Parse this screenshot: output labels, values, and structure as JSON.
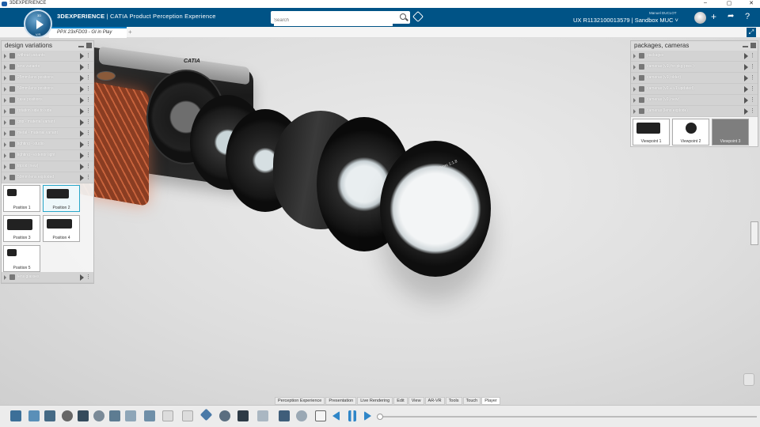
{
  "os_bar": {
    "title": "3DEXPERIENCE"
  },
  "header": {
    "brand_bold": "3DEXPERIENCE",
    "brand_rest": " | CATIA Product Perception Experience",
    "search_placeholder": "Search",
    "user_name": "Manuel DUCLOT",
    "identity": "UX R1132100013579 | Sandbox MUC ˅",
    "compass_top": "3D",
    "compass_bottom": "V,R"
  },
  "tab": {
    "label": "PPX 23xFD03 - GI in Play",
    "add": "+"
  },
  "left_panel": {
    "title": "design variations",
    "rows": [
      "without variants",
      "lens variants",
      "25mm lens positions",
      "50mm lens positions",
      "case positions",
      "rotation side to side",
      "grip - material variant",
      "metal - material variant",
      "lighting - studio",
      "lighting - exterior light",
      "tripod (new)",
      "50mm lens exploded"
    ],
    "thumbs": [
      "Position 1",
      "Position 2",
      "Position 3",
      "Position 4",
      "Position 5"
    ],
    "last_row": "lens glasses"
  },
  "right_panel": {
    "title": "packages, cameras",
    "rows": [
      "packages",
      "cameras (v1, for pkg pres.)",
      "cameras (v1, older)",
      "cameras (v2 + v1 updated)",
      "cameras (v2, new)",
      "cameras (lens explode)"
    ],
    "thumbs": [
      "Viewpoint 1",
      "Viewpoint 2",
      "Viewpoint 3"
    ]
  },
  "viewport": {
    "camera_brand": "CATIA",
    "lens_marking": "50mm  1:1.8"
  },
  "command_tabs": [
    "Perception Experience",
    "Presentation",
    "Live Rendering",
    "Edit",
    "View",
    "AR-VR",
    "Tools",
    "Touch",
    "Player"
  ],
  "active_command_tab": "Player"
}
